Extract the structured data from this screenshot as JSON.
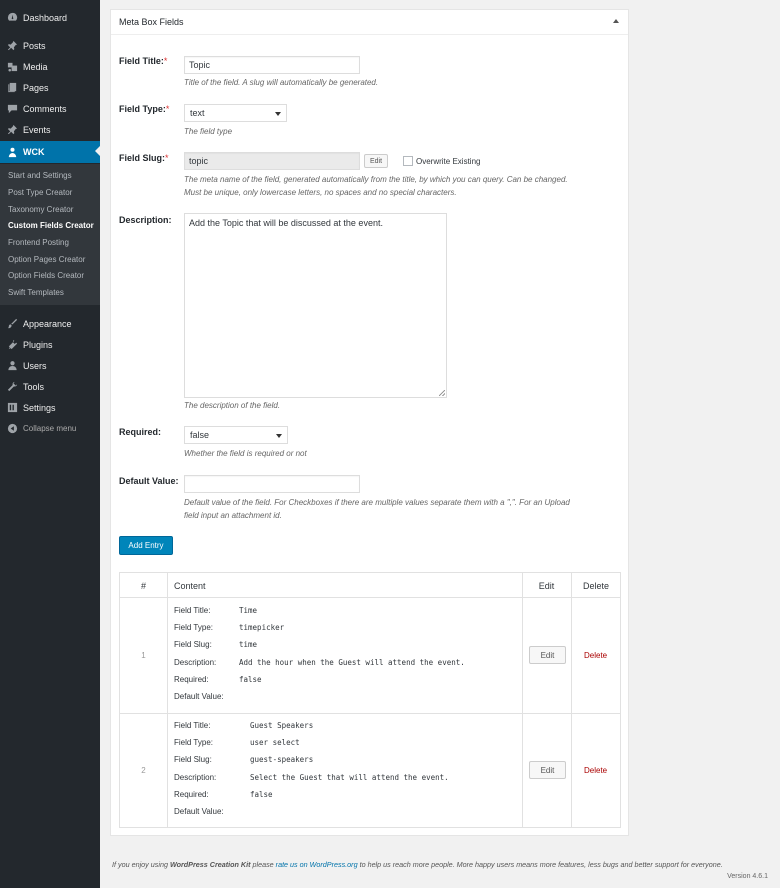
{
  "sidebar": {
    "items": [
      {
        "label": "Dashboard",
        "icon": "dashboard-icon"
      },
      {
        "label": "Posts",
        "icon": "pin-icon"
      },
      {
        "label": "Media",
        "icon": "media-icon"
      },
      {
        "label": "Pages",
        "icon": "pages-icon"
      },
      {
        "label": "Comments",
        "icon": "comments-icon"
      },
      {
        "label": "Events",
        "icon": "pin-icon"
      },
      {
        "label": "WCK",
        "icon": "wck-icon"
      }
    ],
    "submenu": [
      "Start and Settings",
      "Post Type Creator",
      "Taxonomy Creator",
      "Custom Fields Creator",
      "Frontend Posting",
      "Option Pages Creator",
      "Option Fields Creator",
      "Swift Templates"
    ],
    "lower_items": [
      {
        "label": "Appearance",
        "icon": "appearance-icon"
      },
      {
        "label": "Plugins",
        "icon": "plugins-icon"
      },
      {
        "label": "Users",
        "icon": "users-icon"
      },
      {
        "label": "Tools",
        "icon": "tools-icon"
      },
      {
        "label": "Settings",
        "icon": "settings-icon"
      }
    ],
    "collapse": "Collapse menu"
  },
  "panel": {
    "title": "Meta Box Fields",
    "fields": {
      "title": {
        "label": "Field Title:",
        "value": "Topic",
        "desc": "Title of the field. A slug will automatically be generated."
      },
      "type": {
        "label": "Field Type:",
        "value": "text",
        "desc": "The field type"
      },
      "slug": {
        "label": "Field Slug:",
        "value": "topic",
        "edit": "Edit",
        "overwrite": "Overwrite Existing",
        "desc1": "The meta name of the field, generated automatically from the title, by which you can query. Can be changed.",
        "desc2": "Must be unique, only lowercase letters, no spaces and no special characters."
      },
      "description": {
        "label": "Description:",
        "value": "Add the Topic that will be discussed at the event.",
        "desc": "The description of the field."
      },
      "required": {
        "label": "Required:",
        "value": "false",
        "desc": "Whether the field is required or not"
      },
      "default": {
        "label": "Default Value:",
        "value": "",
        "desc1": "Default value of the field. For Checkboxes if there are multiple values separate them with a \",\". For an Upload",
        "desc2": "field input an attachment id."
      }
    },
    "asterisk": "*",
    "add_entry": "Add Entry"
  },
  "entries": {
    "headers": {
      "num": "#",
      "content": "Content",
      "edit": "Edit",
      "delete": "Delete"
    },
    "labels": [
      "Field Title:",
      "Field Type:",
      "Field Slug:",
      "Description:",
      "Required:",
      "Default Value:"
    ],
    "rows": [
      {
        "num": "1",
        "values": [
          "Time",
          "timepicker",
          "time",
          "Add the hour when the Guest will attend the event.",
          "false",
          ""
        ],
        "edit": "Edit",
        "delete": "Delete"
      },
      {
        "num": "2",
        "values": [
          "Guest Speakers",
          "user select",
          "guest-speakers",
          "Select the Guest that will attend the event.",
          "false",
          ""
        ],
        "edit": "Edit",
        "delete": "Delete"
      }
    ]
  },
  "footer": {
    "pre": "If you enjoy using ",
    "brand": "WordPress Creation Kit",
    "mid": " please ",
    "link": "rate us on WordPress.org",
    "post": " to help us reach more people. More happy users means more features, less bugs and better support for everyone.",
    "version": "Version 4.6.1"
  },
  "colors": {
    "accent": "#0073aa",
    "sidebar_bg": "#23282d",
    "button_primary": "#0085ba",
    "delete": "#aa0000",
    "required": "#dc3232"
  }
}
